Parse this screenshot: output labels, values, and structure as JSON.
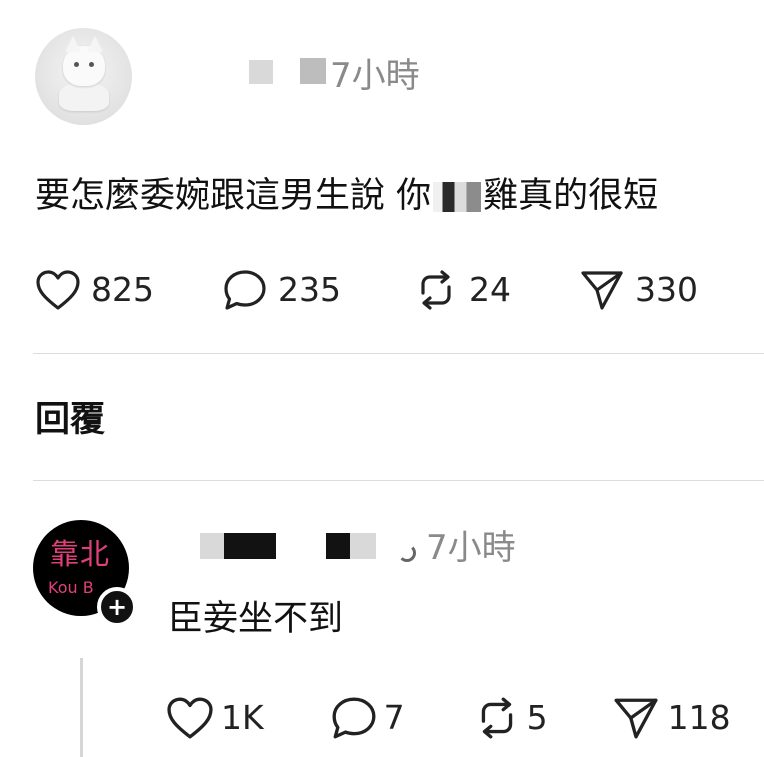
{
  "post": {
    "username": "",
    "time": "7小時",
    "text_before": "要怎麼委婉跟這男生說 你",
    "text_after": "雞真的很短",
    "likes": "825",
    "comments": "235",
    "reposts": "24",
    "shares": "330",
    "avatar_icon": "white-cat-figure-avatar-icon"
  },
  "reply_label": "回覆",
  "reply": {
    "username": "",
    "time": "7小時",
    "text": "臣妾坐不到",
    "likes": "1K",
    "comments": "7",
    "reposts": "5",
    "shares": "118",
    "avatar_text_cn": "靠北",
    "avatar_text_en": "Kou B",
    "avatar_text_color": "#e0407a",
    "follow_badge": "+"
  },
  "icons": {
    "like": "heart-icon",
    "comment": "speech-bubble-icon",
    "repost": "repost-arrows-icon",
    "share": "paper-plane-icon"
  }
}
